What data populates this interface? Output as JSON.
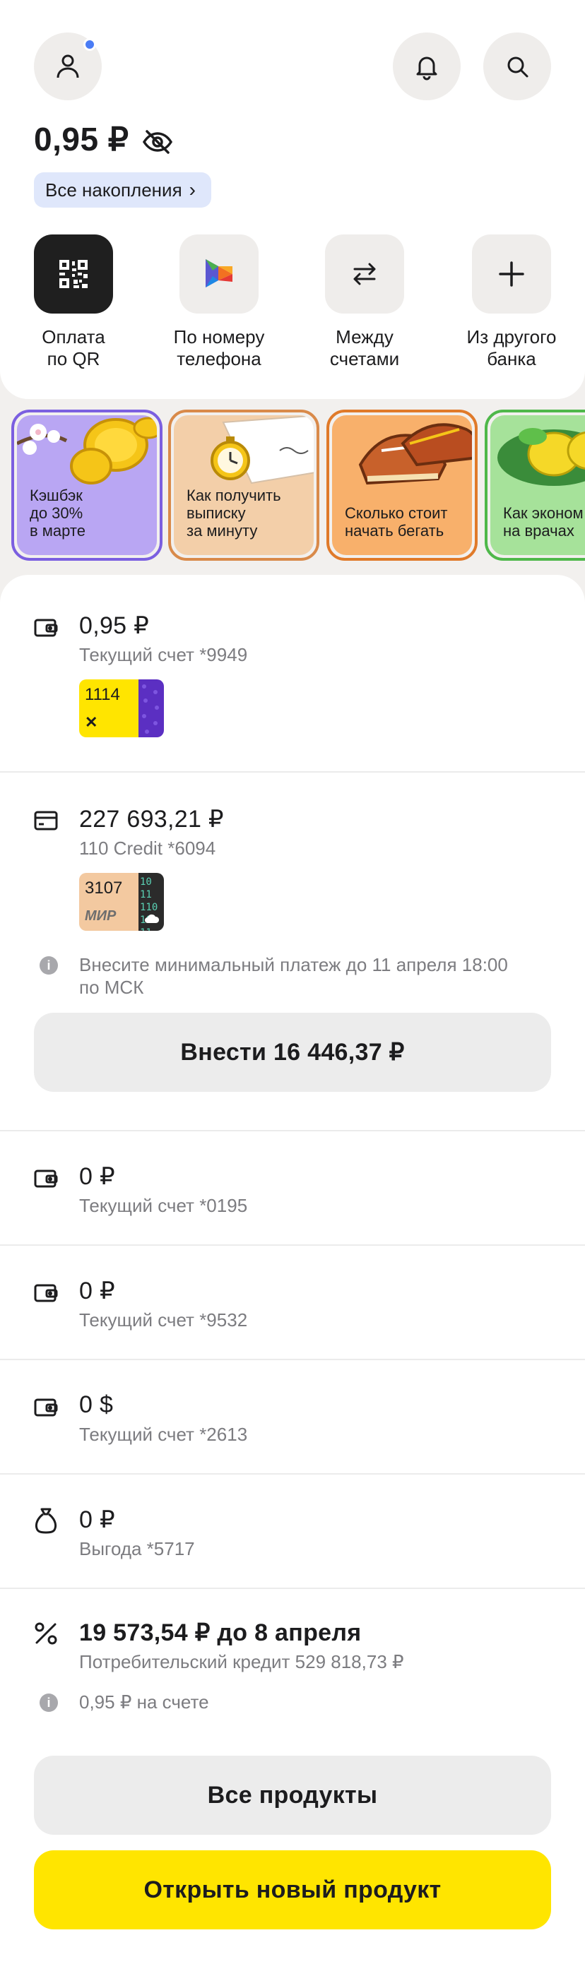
{
  "header": {
    "balance": "0,95 ₽",
    "savings_chip": "Все накопления",
    "savings_chevron": "›"
  },
  "quick_actions": [
    {
      "label": "Оплата\nпо QR",
      "icon": "qr-code-icon"
    },
    {
      "label": "По номеру\nтелефона",
      "icon": "sbp-icon"
    },
    {
      "label": "Между\nсчетами",
      "icon": "transfer-arrows-icon"
    },
    {
      "label": "Из другого\nбанка",
      "icon": "plus-icon"
    }
  ],
  "stories": [
    {
      "title": "Кэшбэк\nдо 30%\nв марте",
      "color": "#b9a6f3",
      "border": "#7b5fe0"
    },
    {
      "title": "Как получить\nвыписку\nза минуту",
      "color": "#f3cfa9",
      "border": "#d98a4a"
    },
    {
      "title": "Сколько стоит\nначать бегать",
      "color": "#f8b06b",
      "border": "#e07a2a"
    },
    {
      "title": "Как эконом\nна врачах",
      "color": "#a6e29a",
      "border": "#4fb84a"
    }
  ],
  "accounts": {
    "current_9949": {
      "amount": "0,95 ₽",
      "name": "Текущий счет *9949",
      "card_number": "1114"
    },
    "credit_6094": {
      "amount": "227 693,21 ₽",
      "name": "110 Credit *6094",
      "card_number": "3107",
      "card_brand": "МИР",
      "card_pattern": "10 11\n110\n10 11",
      "notice": "Внесите минимальный платеж до 11 апреля 18:00\nпо МСК",
      "pay_button": "Внести  16 446,37 ₽"
    },
    "current_0195": {
      "amount": "0 ₽",
      "name": "Текущий счет *0195"
    },
    "current_9532": {
      "amount": "0 ₽",
      "name": "Текущий счет *9532"
    },
    "current_2613": {
      "amount": "0 $",
      "name": "Текущий счет *2613"
    },
    "benefit_5717": {
      "amount": "0 ₽",
      "name": "Выгода *5717"
    },
    "loan": {
      "amount": "19 573,54 ₽ до 8 апреля",
      "name": "Потребительский кредит 529 818,73 ₽",
      "notice": "0,95 ₽ на счете"
    }
  },
  "buttons": {
    "all_products": "Все продукты",
    "open_new_product": "Открыть новый продукт"
  },
  "colors": {
    "accent_yellow": "#ffe500",
    "chip_blue": "#dfe7fb",
    "notif_blue": "#4a7cf5"
  }
}
